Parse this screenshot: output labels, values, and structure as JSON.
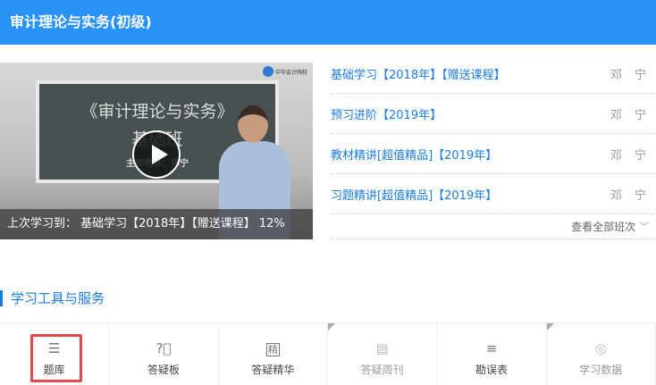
{
  "header": {
    "title": "审计理论与实务(初级)"
  },
  "video": {
    "board_title": "《审计理论与实务》",
    "board_subtitle": "基础班",
    "board_teacher": "主讲老师：邓宁",
    "logo_text": "中华会计网校",
    "progress_label": "上次学习到：",
    "progress_course": "基础学习【2018年】【赠送课程】",
    "progress_percent": "12%"
  },
  "courses": [
    {
      "name": "基础学习【2018年】【赠送课程】",
      "teacher": "邓宁"
    },
    {
      "name": "预习进阶【2019年】",
      "teacher": "邓宁"
    },
    {
      "name": "教材精讲[超值精品]【2019年】",
      "teacher": "邓宁"
    },
    {
      "name": "习题精讲[超值精品]【2019年】",
      "teacher": "邓宁"
    }
  ],
  "more_label": "查看全部班次",
  "section_title": "学习工具与服务",
  "tools": [
    {
      "label": "题库",
      "icon": "list-icon"
    },
    {
      "label": "答疑板",
      "icon": "question-icon"
    },
    {
      "label": "答疑精华",
      "icon": "jing-icon"
    },
    {
      "label": "答疑周刊",
      "icon": "document-icon"
    },
    {
      "label": "勘误表",
      "icon": "menu-icon"
    },
    {
      "label": "学习数据",
      "icon": "target-icon"
    }
  ],
  "colors": {
    "accent": "#2a93fa",
    "link": "#1a7ce0",
    "highlight": "#e5484d"
  }
}
